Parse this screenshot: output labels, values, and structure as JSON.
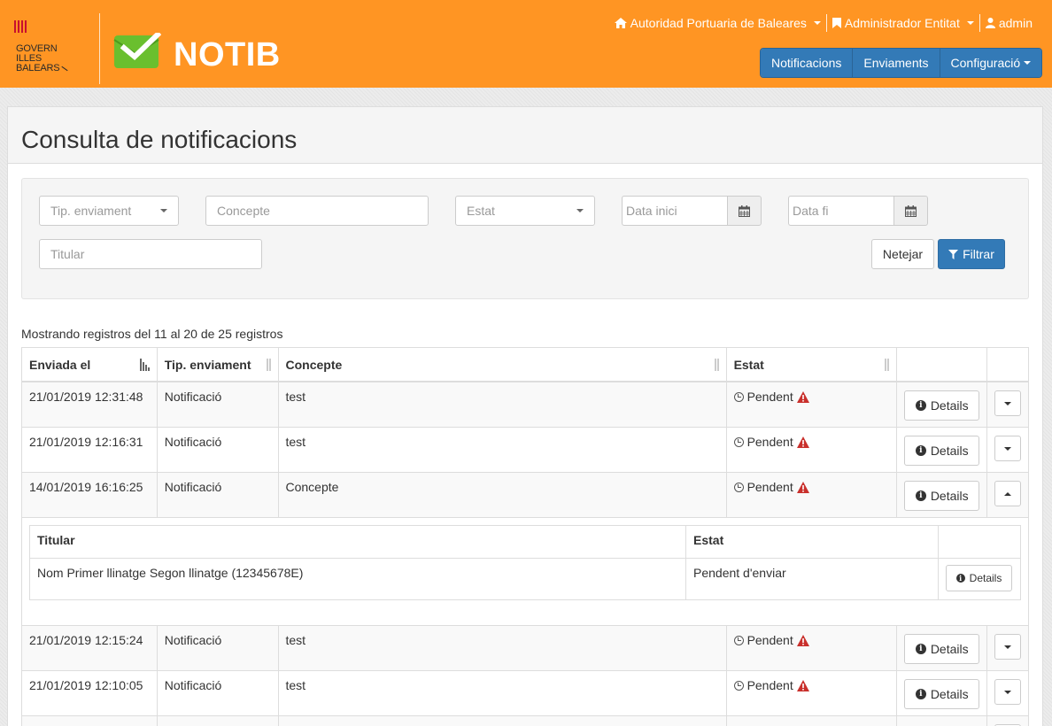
{
  "brand": {
    "gov_line1": "GOVERN",
    "gov_line2": "ILLES",
    "gov_line3": "BALEARS",
    "app_name": "NOTIB",
    "accent": "#ff9523",
    "primary": "#337ab7"
  },
  "user_menu": {
    "entity": "Autoridad Portuaria de Baleares",
    "role": "Administrador Entitat",
    "user": "admin"
  },
  "nav": {
    "notificacions": "Notificacions",
    "enviaments": "Enviaments",
    "configuracio": "Configuració"
  },
  "page": {
    "title": "Consulta de notificacions"
  },
  "filters": {
    "tip_enviament": "Tip. enviament",
    "concepte": "Concepte",
    "estat": "Estat",
    "data_inici": "Data inici",
    "data_fi": "Data fi",
    "titular": "Titular",
    "netejar": "Netejar",
    "filtrar": "Filtrar"
  },
  "table": {
    "info": "Mostrando registros del 11 al 20 de 25 registros",
    "headers": {
      "enviada": "Enviada el",
      "tip": "Tip. enviament",
      "concepte": "Concepte",
      "estat": "Estat"
    },
    "details_label": "Details",
    "rows": [
      {
        "enviada": "21/01/2019 12:31:48",
        "tip": "Notificació",
        "concepte": "test",
        "estat": "Pendent"
      },
      {
        "enviada": "21/01/2019 12:16:31",
        "tip": "Notificació",
        "concepte": "test",
        "estat": "Pendent"
      },
      {
        "enviada": "14/01/2019 16:16:25",
        "tip": "Notificació",
        "concepte": "Concepte",
        "estat": "Pendent"
      },
      {
        "enviada": "21/01/2019 12:15:24",
        "tip": "Notificació",
        "concepte": "test",
        "estat": "Pendent"
      },
      {
        "enviada": "21/01/2019 12:10:05",
        "tip": "Notificació",
        "concepte": "test",
        "estat": "Pendent"
      }
    ],
    "expanded": {
      "titular_header": "Titular",
      "estat_header": "Estat",
      "titular": "Nom Primer llinatge Segon llinatge (12345678E)",
      "estat": "Pendent d'enviar",
      "details": "Details"
    }
  }
}
